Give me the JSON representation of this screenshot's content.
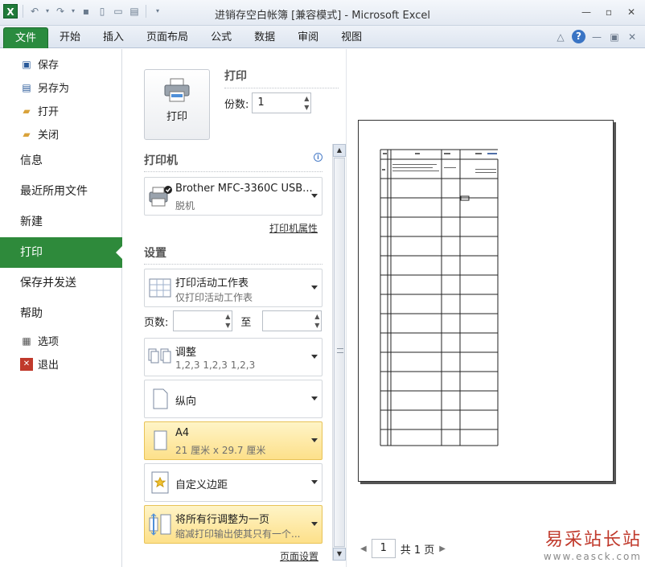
{
  "window": {
    "title": "进销存空白帐簿  [兼容模式]  -  Microsoft Excel",
    "app_icon": "X"
  },
  "ribbon": {
    "tabs": [
      "文件",
      "开始",
      "插入",
      "页面布局",
      "公式",
      "数据",
      "审阅",
      "视图"
    ]
  },
  "leftnav": {
    "small_items_top": [
      {
        "label": "保存",
        "icon": "save-icon"
      },
      {
        "label": "另存为",
        "icon": "save-as-icon"
      },
      {
        "label": "打开",
        "icon": "open-folder-icon"
      },
      {
        "label": "关闭",
        "icon": "close-folder-icon"
      }
    ],
    "big_items": [
      "信息",
      "最近所用文件",
      "新建",
      "打印",
      "保存并发送",
      "帮助"
    ],
    "selected": "打印",
    "small_items_bottom": [
      {
        "label": "选项",
        "icon": "options-icon"
      },
      {
        "label": "退出",
        "icon": "exit-icon"
      }
    ]
  },
  "print": {
    "button_label": "打印",
    "heading": "打印",
    "copies_label": "份数:",
    "copies_value": "1"
  },
  "printer": {
    "heading": "打印机",
    "name": "Brother MFC-3360C USB...",
    "status": "脱机",
    "properties_link": "打印机属性"
  },
  "settings": {
    "heading": "设置",
    "what": {
      "title": "打印活动工作表",
      "subtitle": "仅打印活动工作表"
    },
    "pages_label": "页数:",
    "pages_to": "至",
    "collate": {
      "title": "调整",
      "subtitle": "1,2,3    1,2,3    1,2,3"
    },
    "orientation": {
      "title": "纵向"
    },
    "paper": {
      "title": "A4",
      "subtitle": "21 厘米 x 29.7 厘米"
    },
    "margins": {
      "title": "自定义边距"
    },
    "scaling": {
      "title": "将所有行调整为一页",
      "subtitle": "缩减打印输出使其只有一个..."
    },
    "page_setup_link": "页面设置"
  },
  "preview": {
    "current_page": "1",
    "total_pages": "共 1 页"
  },
  "watermark": {
    "title": "易采站长站",
    "url": "www.easck.com"
  },
  "colors": {
    "file_tab": "#2a8b3f",
    "nav_selected": "#2e8a3b",
    "highlight": "#fde08a"
  }
}
